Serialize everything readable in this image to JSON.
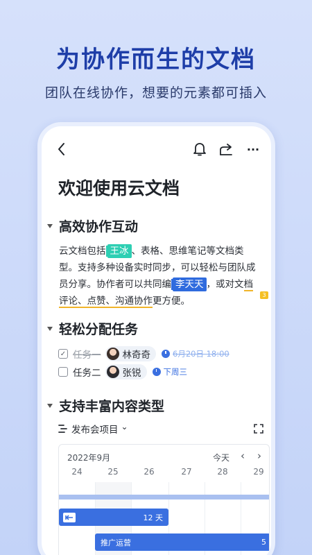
{
  "hero": {
    "title": "为协作而生的文档",
    "subtitle": "团队在线协作，想要的元素都可插入"
  },
  "toolbar": {
    "back_icon": "chevron-left-icon",
    "bell_icon": "bell-icon",
    "share_icon": "share-icon",
    "more_icon": "more-icon",
    "more_label": "···"
  },
  "doc": {
    "title": "欢迎使用云文档",
    "sections": [
      {
        "heading": "高效协作互动"
      },
      {
        "heading": "轻松分配任务"
      },
      {
        "heading": "支持丰富内容类型"
      }
    ],
    "paragraph": {
      "t1": "云文档包括",
      "cursor1": "王冰",
      "t2": "、表格、思维笔记等文档类型。支持多种设备实时同步，可以轻松与团队成员分享。协作者可以共同编",
      "cursor2": "李天天",
      "t3": "，或对文",
      "t4": "档评论、点赞、沟通协作",
      "t5": "更方便。"
    },
    "comment_count": "3",
    "tasks": [
      {
        "checked": true,
        "label": "任务一",
        "assignee": "林奇奇",
        "due": "6月20日 18:00"
      },
      {
        "checked": false,
        "label": "任务二",
        "assignee": "张锐",
        "due": "下周三"
      }
    ],
    "project": {
      "label": "发布会项目",
      "chevron": "⌄"
    },
    "gantt": {
      "month": "2022年9月",
      "today": "今天",
      "prev": "‹",
      "next": "›",
      "days": [
        "24",
        "25",
        "26",
        "27",
        "28",
        "29"
      ],
      "bars": [
        {
          "label": "12 天"
        },
        {
          "label": "推广运营",
          "count": "5"
        }
      ]
    }
  },
  "colors": {
    "brand": "#1e3ea8",
    "accent_blue": "#3a6fe0",
    "accent_green": "#2ecfb3",
    "comment_yellow": "#f5c024"
  }
}
